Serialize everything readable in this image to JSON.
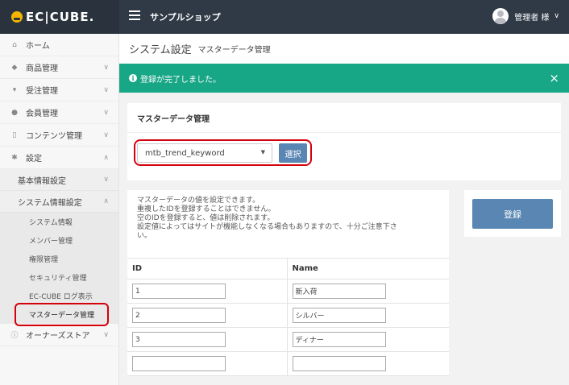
{
  "header": {
    "logo_text": "EC|CUBE.",
    "shop_name": "サンプルショップ",
    "user_label": "管理者 様",
    "user_chevron": "∨"
  },
  "sidebar": {
    "items": [
      {
        "label": "ホーム",
        "icon": "home-icon"
      },
      {
        "label": "商品管理",
        "icon": "tag-icon"
      },
      {
        "label": "受注管理",
        "icon": "cart-icon"
      },
      {
        "label": "会員管理",
        "icon": "users-icon"
      },
      {
        "label": "コンテンツ管理",
        "icon": "file-icon"
      },
      {
        "label": "設定",
        "icon": "gear-icon"
      }
    ],
    "sub_items": [
      {
        "label": "基本情報設定"
      },
      {
        "label": "システム情報設定"
      }
    ],
    "leaf_items": [
      {
        "label": "システム情報"
      },
      {
        "label": "メンバー管理"
      },
      {
        "label": "権限管理"
      },
      {
        "label": "セキュリティ管理"
      },
      {
        "label": "EC-CUBE ログ表示"
      },
      {
        "label": "マスターデータ管理"
      }
    ],
    "owner_store": {
      "label": "オーナーズストア",
      "icon": "info-icon"
    }
  },
  "page": {
    "title": "システム設定",
    "subtitle": "マスターデータ管理"
  },
  "alert": {
    "message": "登録が完了しました。",
    "close": "×",
    "info": "i"
  },
  "master_card": {
    "title": "マスターデータ管理",
    "selected_table": "mtb_trend_keyword",
    "select_button": "選択"
  },
  "data_card": {
    "description_lines": [
      "マスターデータの値を設定できます。",
      "重複したIDを登録することはできません。",
      "空のIDを登録すると、値は削除されます。",
      "設定値によってはサイトが機能しなくなる場合もありますので、十分ご注意下さ",
      "い。"
    ],
    "columns": [
      "ID",
      "Name"
    ],
    "rows": [
      {
        "id": "1",
        "name": "新入荷"
      },
      {
        "id": "2",
        "name": "シルバー"
      },
      {
        "id": "3",
        "name": "ディナー"
      },
      {
        "id": "",
        "name": ""
      }
    ]
  },
  "actions": {
    "register_button": "登録"
  },
  "colors": {
    "topbar": "#2f3a46",
    "alert": "#17a686",
    "button": "#5a86b3",
    "highlight": "#d4000c"
  }
}
